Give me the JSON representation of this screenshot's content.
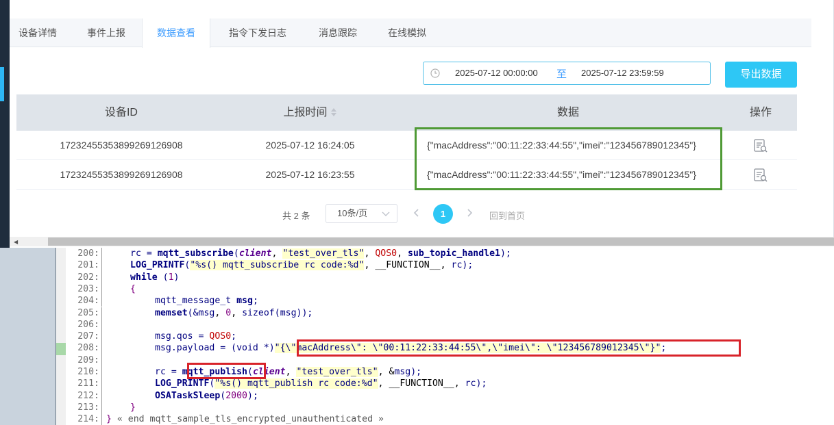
{
  "tabs": [
    {
      "label": "设备详情",
      "active": false
    },
    {
      "label": "事件上报",
      "active": false
    },
    {
      "label": "数据查看",
      "active": true
    },
    {
      "label": "指令下发日志",
      "active": false
    },
    {
      "label": "消息跟踪",
      "active": false
    },
    {
      "label": "在线模拟",
      "active": false
    }
  ],
  "date_range": {
    "start": "2025-07-12 00:00:00",
    "separator": "至",
    "end": "2025-07-12 23:59:59",
    "icon": "clock-icon"
  },
  "export_label": "导出数据",
  "table": {
    "columns": [
      "设备ID",
      "上报时间",
      "数据",
      "操作"
    ],
    "rows": [
      {
        "device_id": "1723245535389926912690 8",
        "time": "2025-07-12 16:24:05",
        "data": "{\"macAddress\":\"00:11:22:33:44:55\",\"imei\":\"123456789012345\"}"
      },
      {
        "device_id": "17232455353899269126908",
        "time": "2025-07-12 16:23:55",
        "data": "{\"macAddress\":\"00:11:22:33:44:55\",\"imei\":\"123456789012345\"}"
      }
    ]
  },
  "pager": {
    "total": "共 2 条",
    "page_size": "10条/页",
    "current": "1",
    "first_page": "回到首页"
  },
  "colors": {
    "accent": "#2ec7f5",
    "sidebar": "#1f2d3d",
    "highlight_green": "#4f9a35",
    "highlight_red": "#d8232a"
  },
  "code": {
    "l200": {
      "n": "200:",
      "a": "rc = ",
      "fn": "mqtt_subscribe",
      "b": "(",
      "p1": "client",
      "c": ", ",
      "s1": "\"test_over_tls\"",
      "d": ", ",
      "k1": "QOS0",
      "e": ", ",
      "f2": "sub_topic_handle1",
      "g": ");"
    },
    "l201": {
      "n": "201:",
      "fn": "LOG_PRINTF",
      "b": "(",
      "s1": "\"%s() mqtt_subscribe rc code:%d\"",
      "c": ", ",
      "m": "__FUNCTION__",
      "d": ", ",
      "v": "rc",
      "e": ");"
    },
    "l202": {
      "n": "202:",
      "kw": "while",
      "b": " (",
      "num": "1",
      "c": ")"
    },
    "l203": {
      "n": "203:",
      "brace": "{"
    },
    "l204": {
      "n": "204:",
      "t": "mqtt_message_t",
      "sp": " ",
      "v": "msg",
      "e": ";"
    },
    "l205": {
      "n": "205:",
      "fn": "memset",
      "b": "(&",
      "v1": "msg",
      "c": ", ",
      "num": "0",
      "d": ", ",
      "kw": "sizeof",
      "e": "(",
      "v2": "msg",
      "f": "));"
    },
    "l206": {
      "n": "206:"
    },
    "l207": {
      "n": "207:",
      "a": "msg.qos = ",
      "k": "QOS0",
      "e": ";"
    },
    "l208": {
      "n": "208:",
      "a": "msg.payload = (void *)",
      "s": "\"{\\\"macAddress\\\": \\\"00:11:22:33:44:55\\\",\\\"imei\\\": \\\"123456789012345\\\"}\"",
      "e": ";"
    },
    "l209": {
      "n": "209:"
    },
    "l210": {
      "n": "210:",
      "a": "rc = ",
      "fn": "mqtt_publish",
      "b": "(",
      "p1": "client",
      "c": ", ",
      "s1": "\"test_over_tls\"",
      "d": ", &",
      "v": "msg",
      "e": ");"
    },
    "l211": {
      "n": "211:",
      "fn": "LOG_PRINTF",
      "b": "(",
      "s1": "\"%s() mqtt_publish rc code:%d\"",
      "c": ", ",
      "m": "__FUNCTION__",
      "d": ", ",
      "v": "rc",
      "e": ");"
    },
    "l212": {
      "n": "212:",
      "fn": "OSATaskSleep",
      "b": "(",
      "num": "2000",
      "e": ");"
    },
    "l213": {
      "n": "213:",
      "brace": "}"
    },
    "l214": {
      "n": "214:",
      "brace": "}",
      "cmt": " « end mqtt_sample_tls_encrypted_unauthenticated »"
    }
  }
}
